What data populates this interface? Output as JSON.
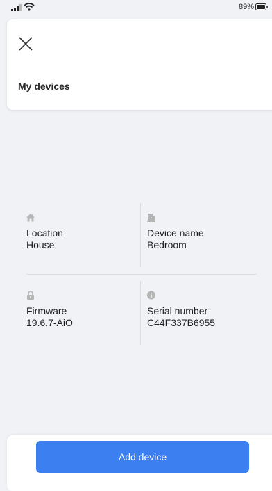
{
  "status_bar": {
    "battery_percent": "89%",
    "icons": [
      "signal-icon",
      "wifi-icon",
      "battery-icon"
    ]
  },
  "header": {
    "close_icon": "close-icon",
    "title": "My devices"
  },
  "details": [
    {
      "icon": "house-icon",
      "label": "Location",
      "value": "House"
    },
    {
      "icon": "door-icon",
      "label": "Device name",
      "value": "Bedroom"
    },
    {
      "icon": "lock-icon",
      "label": "Firmware",
      "value": "19.6.7-AiO"
    },
    {
      "icon": "info-icon",
      "label": "Serial number",
      "value": "C44F337B6955"
    }
  ],
  "footer": {
    "add_device_label": "Add device"
  },
  "colors": {
    "accent": "#3b7ff0",
    "background": "#f1f2f5",
    "icon": "#b5b5b5"
  }
}
